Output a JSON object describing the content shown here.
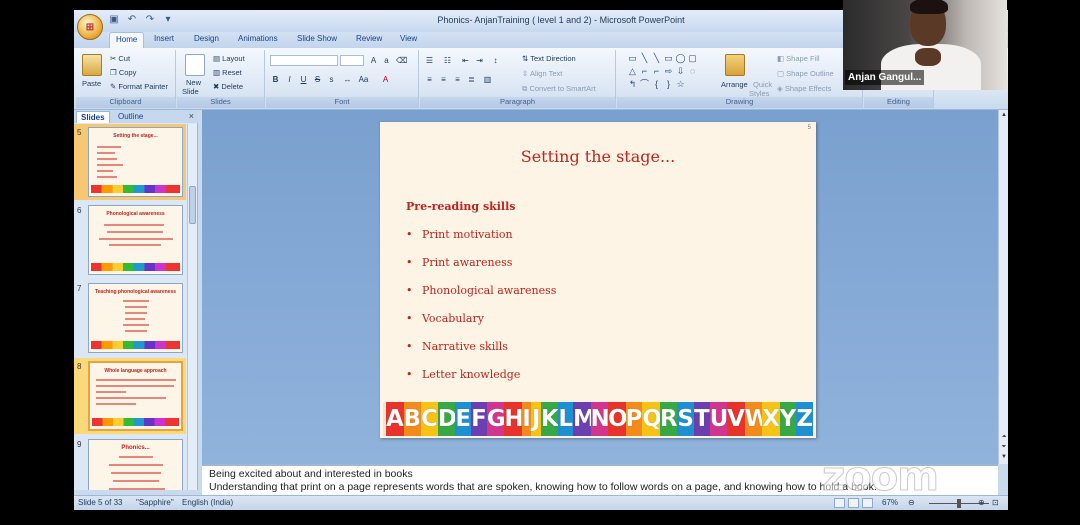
{
  "window": {
    "title": "Phonics- AnjanTraining ( level 1 and 2) - Microsoft PowerPoint"
  },
  "tabs": [
    "Home",
    "Insert",
    "Design",
    "Animations",
    "Slide Show",
    "Review",
    "View"
  ],
  "ribbon": {
    "clipboard": {
      "label": "Clipboard",
      "paste": "Paste",
      "cut": "Cut",
      "copy": "Copy",
      "format_painter": "Format Painter"
    },
    "slides": {
      "label": "Slides",
      "new_slide": "New",
      "new_slide2": "Slide",
      "layout": "Layout",
      "reset": "Reset",
      "delete": "Delete"
    },
    "font": {
      "label": "Font"
    },
    "paragraph": {
      "label": "Paragraph",
      "text_direction": "Text Direction",
      "align_text": "Align Text",
      "convert": "Convert to SmartArt"
    },
    "drawing": {
      "label": "Drawing",
      "arrange": "Arrange",
      "quick_styles": "Quick",
      "quick_styles2": "Styles",
      "shape_fill": "Shape Fill",
      "shape_outline": "Shape Outline",
      "shape_effects": "Shape Effects"
    },
    "editing": {
      "label": "Editing"
    }
  },
  "panel": {
    "tab_slides": "Slides",
    "tab_outline": "Outline",
    "close": "×"
  },
  "thumbnails": [
    {
      "num": "5",
      "title": "Setting the stage..."
    },
    {
      "num": "6",
      "title": "Phonological awareness"
    },
    {
      "num": "7",
      "title": "Teaching phonological awareness"
    },
    {
      "num": "8",
      "title": "Whole language approach"
    },
    {
      "num": "9",
      "title": "Phonics..."
    }
  ],
  "slide": {
    "number": "5",
    "title": "Setting the stage...",
    "subtitle": "Pre-reading skills",
    "bullets": [
      "Print motivation",
      "Print awareness",
      "Phonological awareness",
      "Vocabulary",
      "Narrative skills",
      "Letter knowledge"
    ],
    "alphabet": "ABCDEFGHIJKLMNOPQRSTUVWXYZ",
    "letter_colors": [
      "#e8332b",
      "#f28a1c",
      "#f5c315",
      "#37a844",
      "#1e8fd1",
      "#6c3fb0",
      "#d1368f",
      "#e8332b",
      "#f28a1c",
      "#f5c315",
      "#37a844",
      "#1e8fd1",
      "#6c3fb0",
      "#d1368f",
      "#e8332b",
      "#f28a1c",
      "#f5c315",
      "#37a844",
      "#1e8fd1",
      "#6c3fb0",
      "#d1368f",
      "#e8332b",
      "#f28a1c",
      "#f5c315",
      "#37a844",
      "#1e8fd1"
    ]
  },
  "notes": {
    "line1": "Being excited about and interested in books",
    "line2": "Understanding that print on a page represents words that are spoken, knowing how to follow words on a page, and knowing how to hold a book."
  },
  "status": {
    "slide": "Slide 5 of 33",
    "theme": "\"Sapphire\"",
    "language": "English (India)",
    "zoom": "67%"
  },
  "webcam": {
    "name": "Anjan Gangul..."
  },
  "watermark": "zoom"
}
